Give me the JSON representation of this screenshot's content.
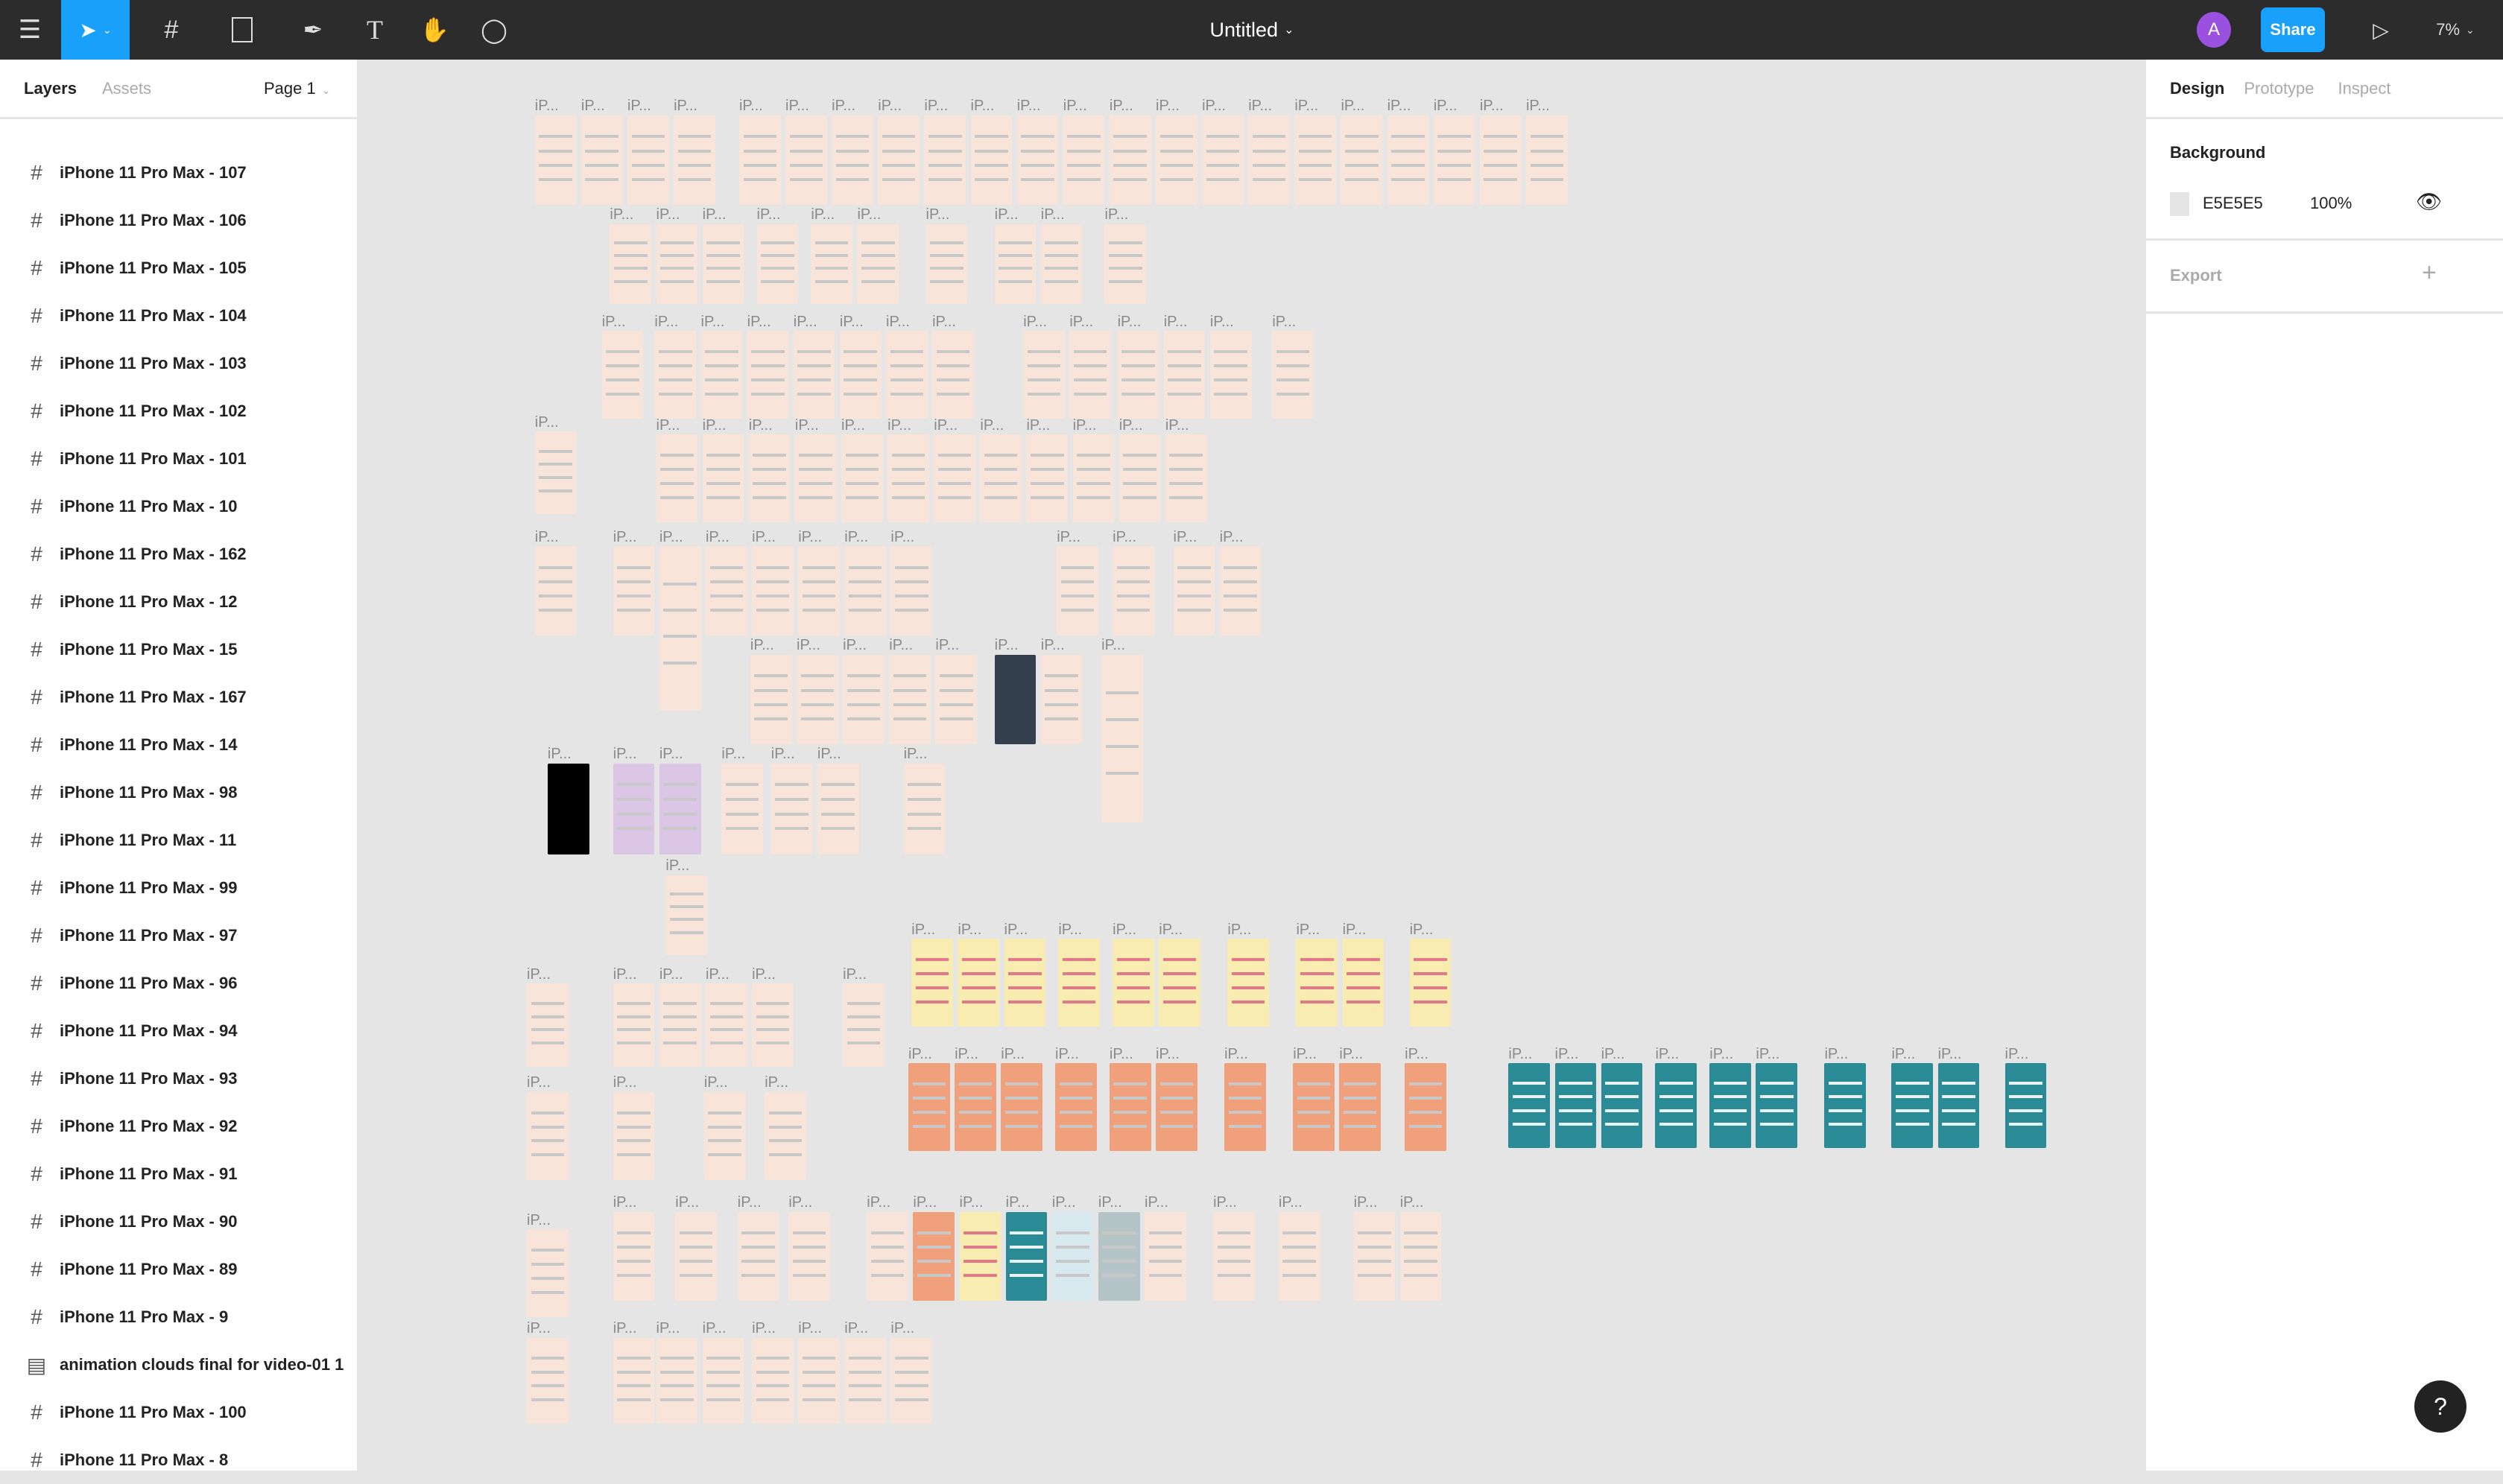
{
  "toolbar": {
    "title": "Untitled",
    "share": "Share",
    "zoom": "7%",
    "avatar": "A",
    "accent": "#18a0fb",
    "avatar_color": "#9b51e0"
  },
  "left_panel": {
    "tab_layers": "Layers",
    "tab_assets": "Assets",
    "page": "Page 1",
    "layers": [
      {
        "label": "iPhone 11 Pro Max - 107",
        "icon": "frame-icon"
      },
      {
        "label": "iPhone 11 Pro Max - 106",
        "icon": "frame-icon"
      },
      {
        "label": "iPhone 11 Pro Max - 105",
        "icon": "frame-icon"
      },
      {
        "label": "iPhone 11 Pro Max - 104",
        "icon": "frame-icon"
      },
      {
        "label": "iPhone 11 Pro Max - 103",
        "icon": "frame-icon"
      },
      {
        "label": "iPhone 11 Pro Max - 102",
        "icon": "frame-icon"
      },
      {
        "label": "iPhone 11 Pro Max - 101",
        "icon": "frame-icon"
      },
      {
        "label": "iPhone 11 Pro Max - 10",
        "icon": "frame-icon"
      },
      {
        "label": "iPhone 11 Pro Max - 162",
        "icon": "frame-icon"
      },
      {
        "label": "iPhone 11 Pro Max - 12",
        "icon": "frame-icon"
      },
      {
        "label": "iPhone 11 Pro Max - 15",
        "icon": "frame-icon"
      },
      {
        "label": "iPhone 11 Pro Max - 167",
        "icon": "frame-icon"
      },
      {
        "label": "iPhone 11 Pro Max - 14",
        "icon": "frame-icon"
      },
      {
        "label": "iPhone 11 Pro Max - 98",
        "icon": "frame-icon"
      },
      {
        "label": "iPhone 11 Pro Max - 11",
        "icon": "frame-icon"
      },
      {
        "label": "iPhone 11 Pro Max - 99",
        "icon": "frame-icon"
      },
      {
        "label": "iPhone 11 Pro Max - 97",
        "icon": "frame-icon"
      },
      {
        "label": "iPhone 11 Pro Max - 96",
        "icon": "frame-icon"
      },
      {
        "label": "iPhone 11 Pro Max - 94",
        "icon": "frame-icon"
      },
      {
        "label": "iPhone 11 Pro Max - 93",
        "icon": "frame-icon"
      },
      {
        "label": "iPhone 11 Pro Max - 92",
        "icon": "frame-icon"
      },
      {
        "label": "iPhone 11 Pro Max - 91",
        "icon": "frame-icon"
      },
      {
        "label": "iPhone 11 Pro Max - 90",
        "icon": "frame-icon"
      },
      {
        "label": "iPhone 11 Pro Max - 89",
        "icon": "frame-icon"
      },
      {
        "label": "iPhone 11 Pro Max - 9",
        "icon": "frame-icon"
      },
      {
        "label": "animation clouds final for video-01 1",
        "icon": "image-icon"
      },
      {
        "label": "iPhone 11 Pro Max - 100",
        "icon": "frame-icon"
      },
      {
        "label": "iPhone 11 Pro Max - 8",
        "icon": "frame-icon"
      }
    ]
  },
  "right_panel": {
    "tab_design": "Design",
    "tab_prototype": "Prototype",
    "tab_inspect": "Inspect",
    "background_label": "Background",
    "background_hex": "E5E5E5",
    "background_opacity": "100%",
    "export_label": "Export"
  },
  "canvas": {
    "frame_label": "iP...",
    "colors": {
      "pink": "#f8e4d8",
      "yellow": "#f9ecb0",
      "orange": "#f0a07a",
      "teal": "#2a8a95",
      "lavender": "#dcc6e6",
      "black": "#000000",
      "dark": "#34404e",
      "lightblue": "#d8e8ef",
      "greyblue": "#b5c4c6"
    }
  },
  "help": "?"
}
